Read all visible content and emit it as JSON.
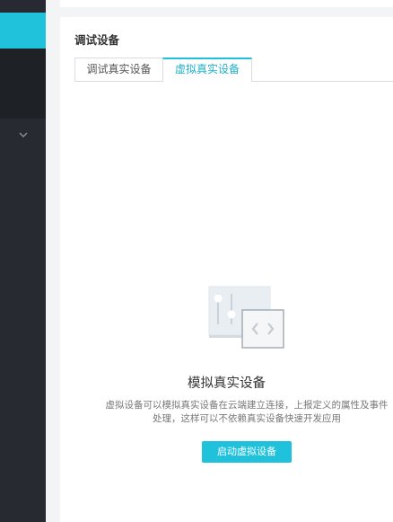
{
  "section": {
    "title": "调试设备"
  },
  "tabs": [
    {
      "label": "调试真实设备",
      "active": false
    },
    {
      "label": "虚拟真实设备",
      "active": true
    }
  ],
  "empty_state": {
    "title": "模拟真实设备",
    "description": "虚拟设备可以模拟真实设备在云端建立连接，上报定义的属性及事件处理，这样可以不依赖真实设备快速开发应用",
    "button_label": "启动虚拟设备",
    "illustration": "virtual-device-illustration"
  },
  "sidebar": {
    "expand_icon": "chevron-down-icon"
  },
  "colors": {
    "accent": "#20c2db",
    "sidebar_bg": "#272b31",
    "sidebar_dark": "#1e2126",
    "page_bg": "#f3f4f6"
  }
}
